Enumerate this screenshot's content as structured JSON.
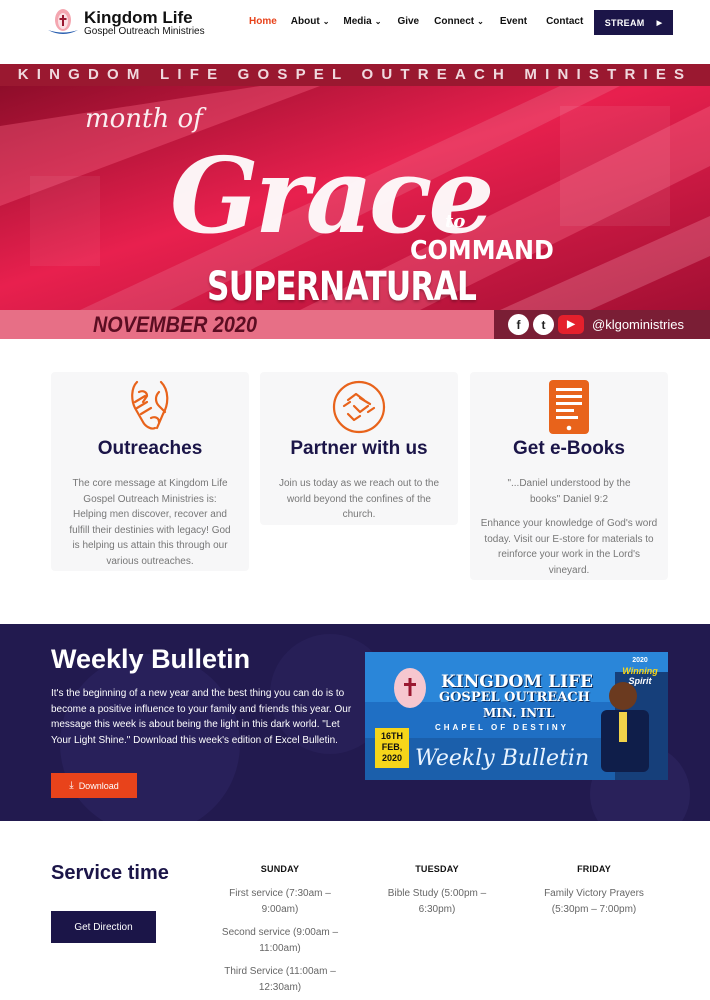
{
  "header": {
    "logo_title": "Kingdom Life",
    "logo_sub": "Gospel Outreach Ministries",
    "nav": [
      {
        "label": "Home",
        "active": true,
        "dropdown": false
      },
      {
        "label": "About",
        "active": false,
        "dropdown": true
      },
      {
        "label": "Media",
        "active": false,
        "dropdown": true
      },
      {
        "label": "Give",
        "active": false,
        "dropdown": false
      },
      {
        "label": "Connect",
        "active": false,
        "dropdown": true
      },
      {
        "label": "Event",
        "active": false,
        "dropdown": false
      },
      {
        "label": "Contact",
        "active": false,
        "dropdown": false
      }
    ],
    "stream_label": "STREAM"
  },
  "hero": {
    "top_banner": "KINGDOM LIFE GOSPEL OUTREACH MINISTRIES",
    "month_of": "month of",
    "grace": "Grace",
    "to": "to",
    "command": "COMMAND",
    "supernatural": "SUPERNATURAL RESULTS",
    "date": "NOVEMBER 2020",
    "handle": "@klgoministries"
  },
  "cards": [
    {
      "icon": "helping-hands-icon",
      "title": "Outreaches",
      "paragraphs": [
        "The core message at Kingdom Life Gospel Outreach Ministries is: Helping men discover, recover and fulfill their destinies with legacy! God is helping us attain this through our various outreaches."
      ]
    },
    {
      "icon": "partnership-hands-icon",
      "title": "Partner with us",
      "paragraphs": [
        "Join us today as we reach out to the world beyond the confines of the church."
      ]
    },
    {
      "icon": "ebook-tablet-icon",
      "title": "Get e-Books",
      "paragraphs": [
        "\"...Daniel understood by the books\" Daniel 9:2",
        "Enhance your knowledge of God's word today. Visit our E-store for materials to reinforce your work in the Lord's vineyard."
      ]
    }
  ],
  "bulletin": {
    "title": "Weekly Bulletin",
    "text": "It's the beginning of a new year and the best thing you can do is to become a positive influence to your family and friends this year. Our message this week is about being the light in this dark world. \"Let Your Light Shine.\" Download this week's edition of Excel Bulletin.",
    "download_label": "Download",
    "image": {
      "line1": "KINGDOM LIFE",
      "line2": "GOSPEL OUTREACH",
      "line3": "MIN. INTL",
      "chapel": "CHAPEL OF DESTINY",
      "date_l1": "16TH",
      "date_l2": "FEB,",
      "date_l3": "2020",
      "script": "Weekly Bulletin",
      "badge_top": "2020",
      "badge_main": "Winning",
      "badge_sub": "Spirit"
    }
  },
  "service": {
    "title": "Service time",
    "direction_label": "Get Direction",
    "days": [
      {
        "day": "SUNDAY",
        "sessions": [
          "First service (7:30am – 9:00am)",
          "Second service (9:00am – 11:00am)",
          "Third Service (11:00am – 12:30am)"
        ]
      },
      {
        "day": "TUESDAY",
        "sessions": [
          "Bible Study (5:00pm – 6:30pm)"
        ]
      },
      {
        "day": "FRIDAY",
        "sessions": [
          "Family Victory Prayers (5:30pm – 7:00pm)"
        ]
      }
    ]
  },
  "colors": {
    "navy": "#1b1548",
    "accent_orange": "#e8431b",
    "nav_active": "#e8431b",
    "bulletin_bg": "#221a4f",
    "hero_red": "#c5103a"
  }
}
